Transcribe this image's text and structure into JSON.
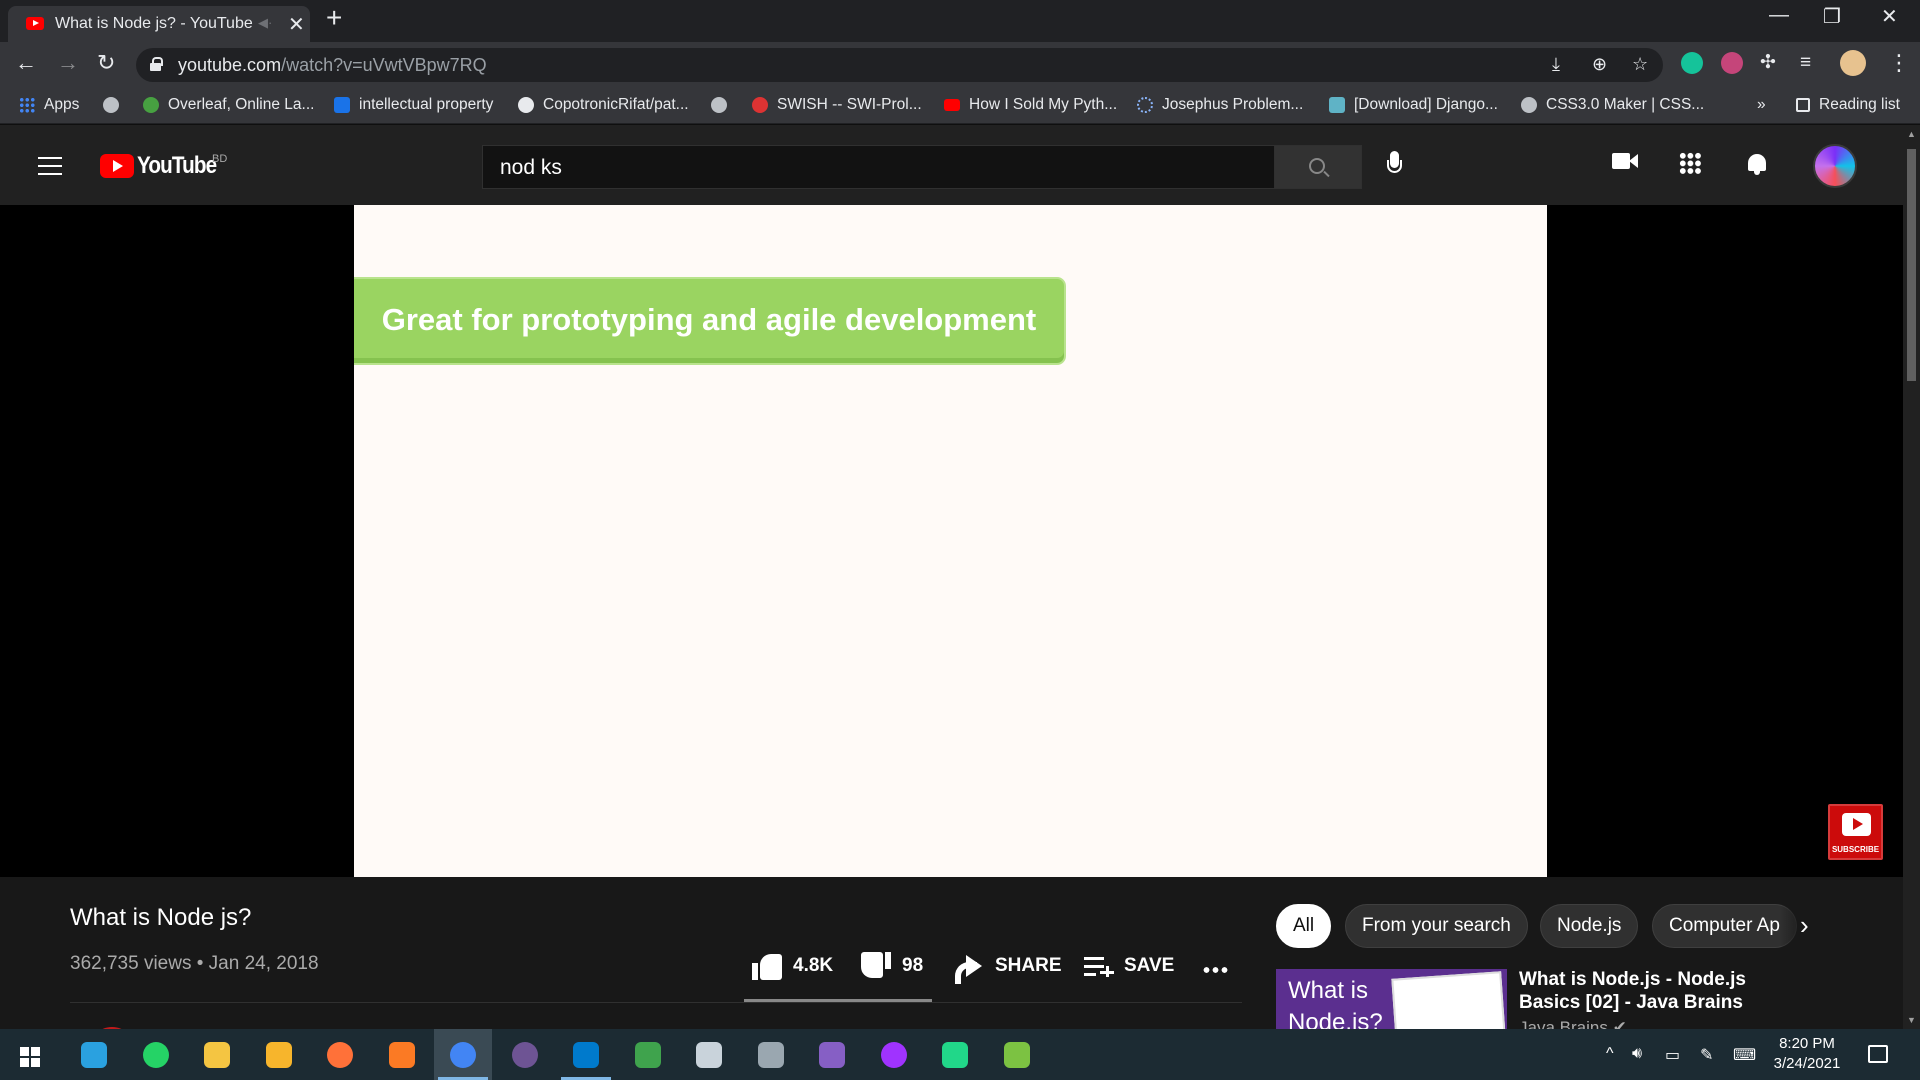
{
  "browser": {
    "tab_title": "What is Node js? - YouTube",
    "tab_audio_icon": "muted-speaker",
    "tab_close": "✕",
    "new_tab": "+",
    "url_host": "youtube.com",
    "url_path": "/watch?v=uVwtVBpw7RQ",
    "window_controls": {
      "minimize": "—",
      "restore": "❐",
      "close": "✕"
    },
    "bookmarks": [
      {
        "label": "Apps",
        "icon": "apps-grid-icon",
        "color": "#4285f4"
      },
      {
        "label": "",
        "icon": "globe-icon",
        "color": "#bdc1c6"
      },
      {
        "label": "Overleaf, Online La...",
        "icon": "overleaf-icon",
        "color": "#47a141"
      },
      {
        "label": "intellectual property",
        "icon": "scholar-icon",
        "color": "#1a73e8"
      },
      {
        "label": "CopotronicRifat/pat...",
        "icon": "github-icon",
        "color": "#e8eaed"
      },
      {
        "label": "",
        "icon": "globe-icon",
        "color": "#bdc1c6"
      },
      {
        "label": "SWISH -- SWI-Prol...",
        "icon": "swish-icon",
        "color": "#d33"
      },
      {
        "label": "How I Sold My Pyth...",
        "icon": "youtube-icon",
        "color": "#ff0000"
      },
      {
        "label": "Josephus Problem...",
        "icon": "loading-icon",
        "color": "#8ab4f8"
      },
      {
        "label": "[Download] Django...",
        "icon": "site-icon",
        "color": "#5fb3c6"
      },
      {
        "label": "CSS3.0 Maker | CSS...",
        "icon": "globe-icon",
        "color": "#bdc1c6"
      }
    ],
    "bookmarks_overflow": "»",
    "reading_list": "Reading list"
  },
  "youtube": {
    "logo_text": "YouTube",
    "country_code": "BD",
    "search_value": "nod ks",
    "colors": {
      "brand_red": "#ff0000",
      "header_bg": "#212121",
      "page_bg": "#181818"
    }
  },
  "player": {
    "slide_text": "Great for prototyping and agile development",
    "slide_banner_color": "#9ad461",
    "watermark_label": "SUBSCRIBE"
  },
  "video": {
    "title": "What is Node js?",
    "meta": "362,735 views • Jan 24, 2018",
    "likes": "4.8K",
    "dislikes": "98",
    "share_label": "SHARE",
    "save_label": "SAVE",
    "like_ratio": 0.98
  },
  "sidebar": {
    "chips": [
      "All",
      "From your search",
      "Node.js",
      "Computer Ap"
    ],
    "active_chip": "All",
    "next_arrow": "›",
    "recommendation": {
      "thumb_text": "What is Node.js?",
      "title": "What is Node.js - Node.js Basics [02] - Java Brains",
      "channel": "Java Brains"
    }
  },
  "taskbar": {
    "apps": [
      {
        "name": "taskbar-settings-icon",
        "color": "#2aa1e0"
      },
      {
        "name": "taskbar-whatsapp-icon",
        "color": "#25d366"
      },
      {
        "name": "taskbar-file-explorer-icon",
        "color": "#f4c542"
      },
      {
        "name": "taskbar-app-icon",
        "color": "#f7b52c"
      },
      {
        "name": "taskbar-firefox-icon",
        "color": "#ff7139"
      },
      {
        "name": "taskbar-xampp-icon",
        "color": "#fb7a24"
      },
      {
        "name": "taskbar-chrome-icon",
        "color": "#4285f4"
      },
      {
        "name": "taskbar-github-desktop-icon",
        "color": "#6e5494"
      },
      {
        "name": "taskbar-vscode-icon",
        "color": "#007acc"
      },
      {
        "name": "taskbar-app-icon",
        "color": "#3fa34d"
      },
      {
        "name": "taskbar-app-icon",
        "color": "#c9d3db"
      },
      {
        "name": "taskbar-app-icon",
        "color": "#9aa7b0"
      },
      {
        "name": "taskbar-visual-studio-icon",
        "color": "#865fc5"
      },
      {
        "name": "taskbar-messenger-icon",
        "color": "#a033ff"
      },
      {
        "name": "taskbar-pycharm-icon",
        "color": "#21d789"
      },
      {
        "name": "taskbar-app-icon",
        "color": "#7cc242"
      }
    ],
    "time": "8:20 PM",
    "date": "3/24/2021"
  }
}
